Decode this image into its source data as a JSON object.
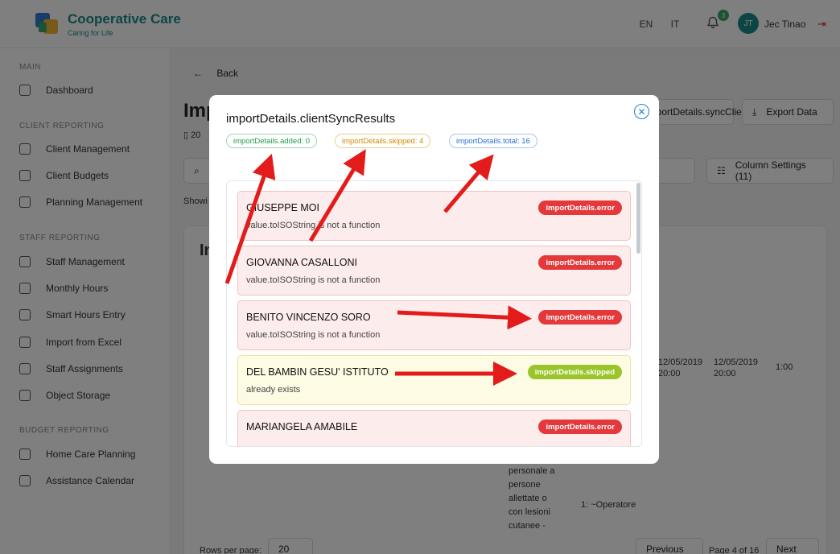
{
  "app": {
    "brand": "Cooperative Care",
    "tagline": "Caring for Life",
    "lang_en": "EN",
    "lang_it": "IT",
    "notifications_count": "3",
    "user_initials": "JT",
    "user_name": "Jec Tinao"
  },
  "sidebar": {
    "main_title": "MAIN",
    "dashboard": "Dashboard",
    "client_title": "CLIENT REPORTING",
    "client_items": [
      "Client Management",
      "Client Budgets",
      "Planning Management"
    ],
    "staff_title": "STAFF REPORTING",
    "staff_items": [
      "Staff Management",
      "Monthly Hours",
      "Smart Hours Entry",
      "Import from Excel",
      "Staff Assignments",
      "Object Storage"
    ],
    "budget_title": "BUDGET REPORTING",
    "budget_items": [
      "Home Care Planning",
      "Assistance Calendar"
    ]
  },
  "main": {
    "back": "Back",
    "title": "Imp",
    "sync_clients": "importDetails.syncClients",
    "export": "Export Data",
    "column_settings": "Column Settings (11)",
    "showing": "Showi",
    "card_title": "In",
    "date1": "12/05/2019",
    "date2": "20:00",
    "date3": "12/05/2019",
    "date4": "20:00",
    "duration": "1:00",
    "desc": "personale a persone allettate o con lesioni cutanee -",
    "op": "1: ~Operatore",
    "rows_per_page": "Rows per page:",
    "rows_value": "20",
    "previous": "Previous",
    "page_of": "Page 4 of 16",
    "next": "Next"
  },
  "modal": {
    "title": "importDetails.clientSyncResults",
    "chip_added": "importDetails.added: 0",
    "chip_skipped": "importDetails.skipped: 4",
    "chip_total": "importDetails.total: 16",
    "rows": [
      {
        "name": "GIUSEPPE MOI",
        "message": "value.toISOString is not a function",
        "status": "importDetails.error"
      },
      {
        "name": "GIOVANNA CASALLONI",
        "message": "value.toISOString is not a function",
        "status": "importDetails.error"
      },
      {
        "name": "BENITO VINCENZO SORO",
        "message": "value.toISOString is not a function",
        "status": "importDetails.error"
      },
      {
        "name": "DEL BAMBIN GESU' ISTITUTO",
        "message": "already exists",
        "status": "importDetails.skipped"
      },
      {
        "name": "MARIANGELA AMABILE",
        "message": "",
        "status": "importDetails.error"
      }
    ]
  },
  "colors": {
    "error": "#e5383b",
    "skipped": "#9ac52a",
    "added_chip": "#1f9d4a",
    "skipped_chip": "#d08a00",
    "total_chip": "#2a6fd6",
    "annotation_arrow": "#e31b1b"
  }
}
